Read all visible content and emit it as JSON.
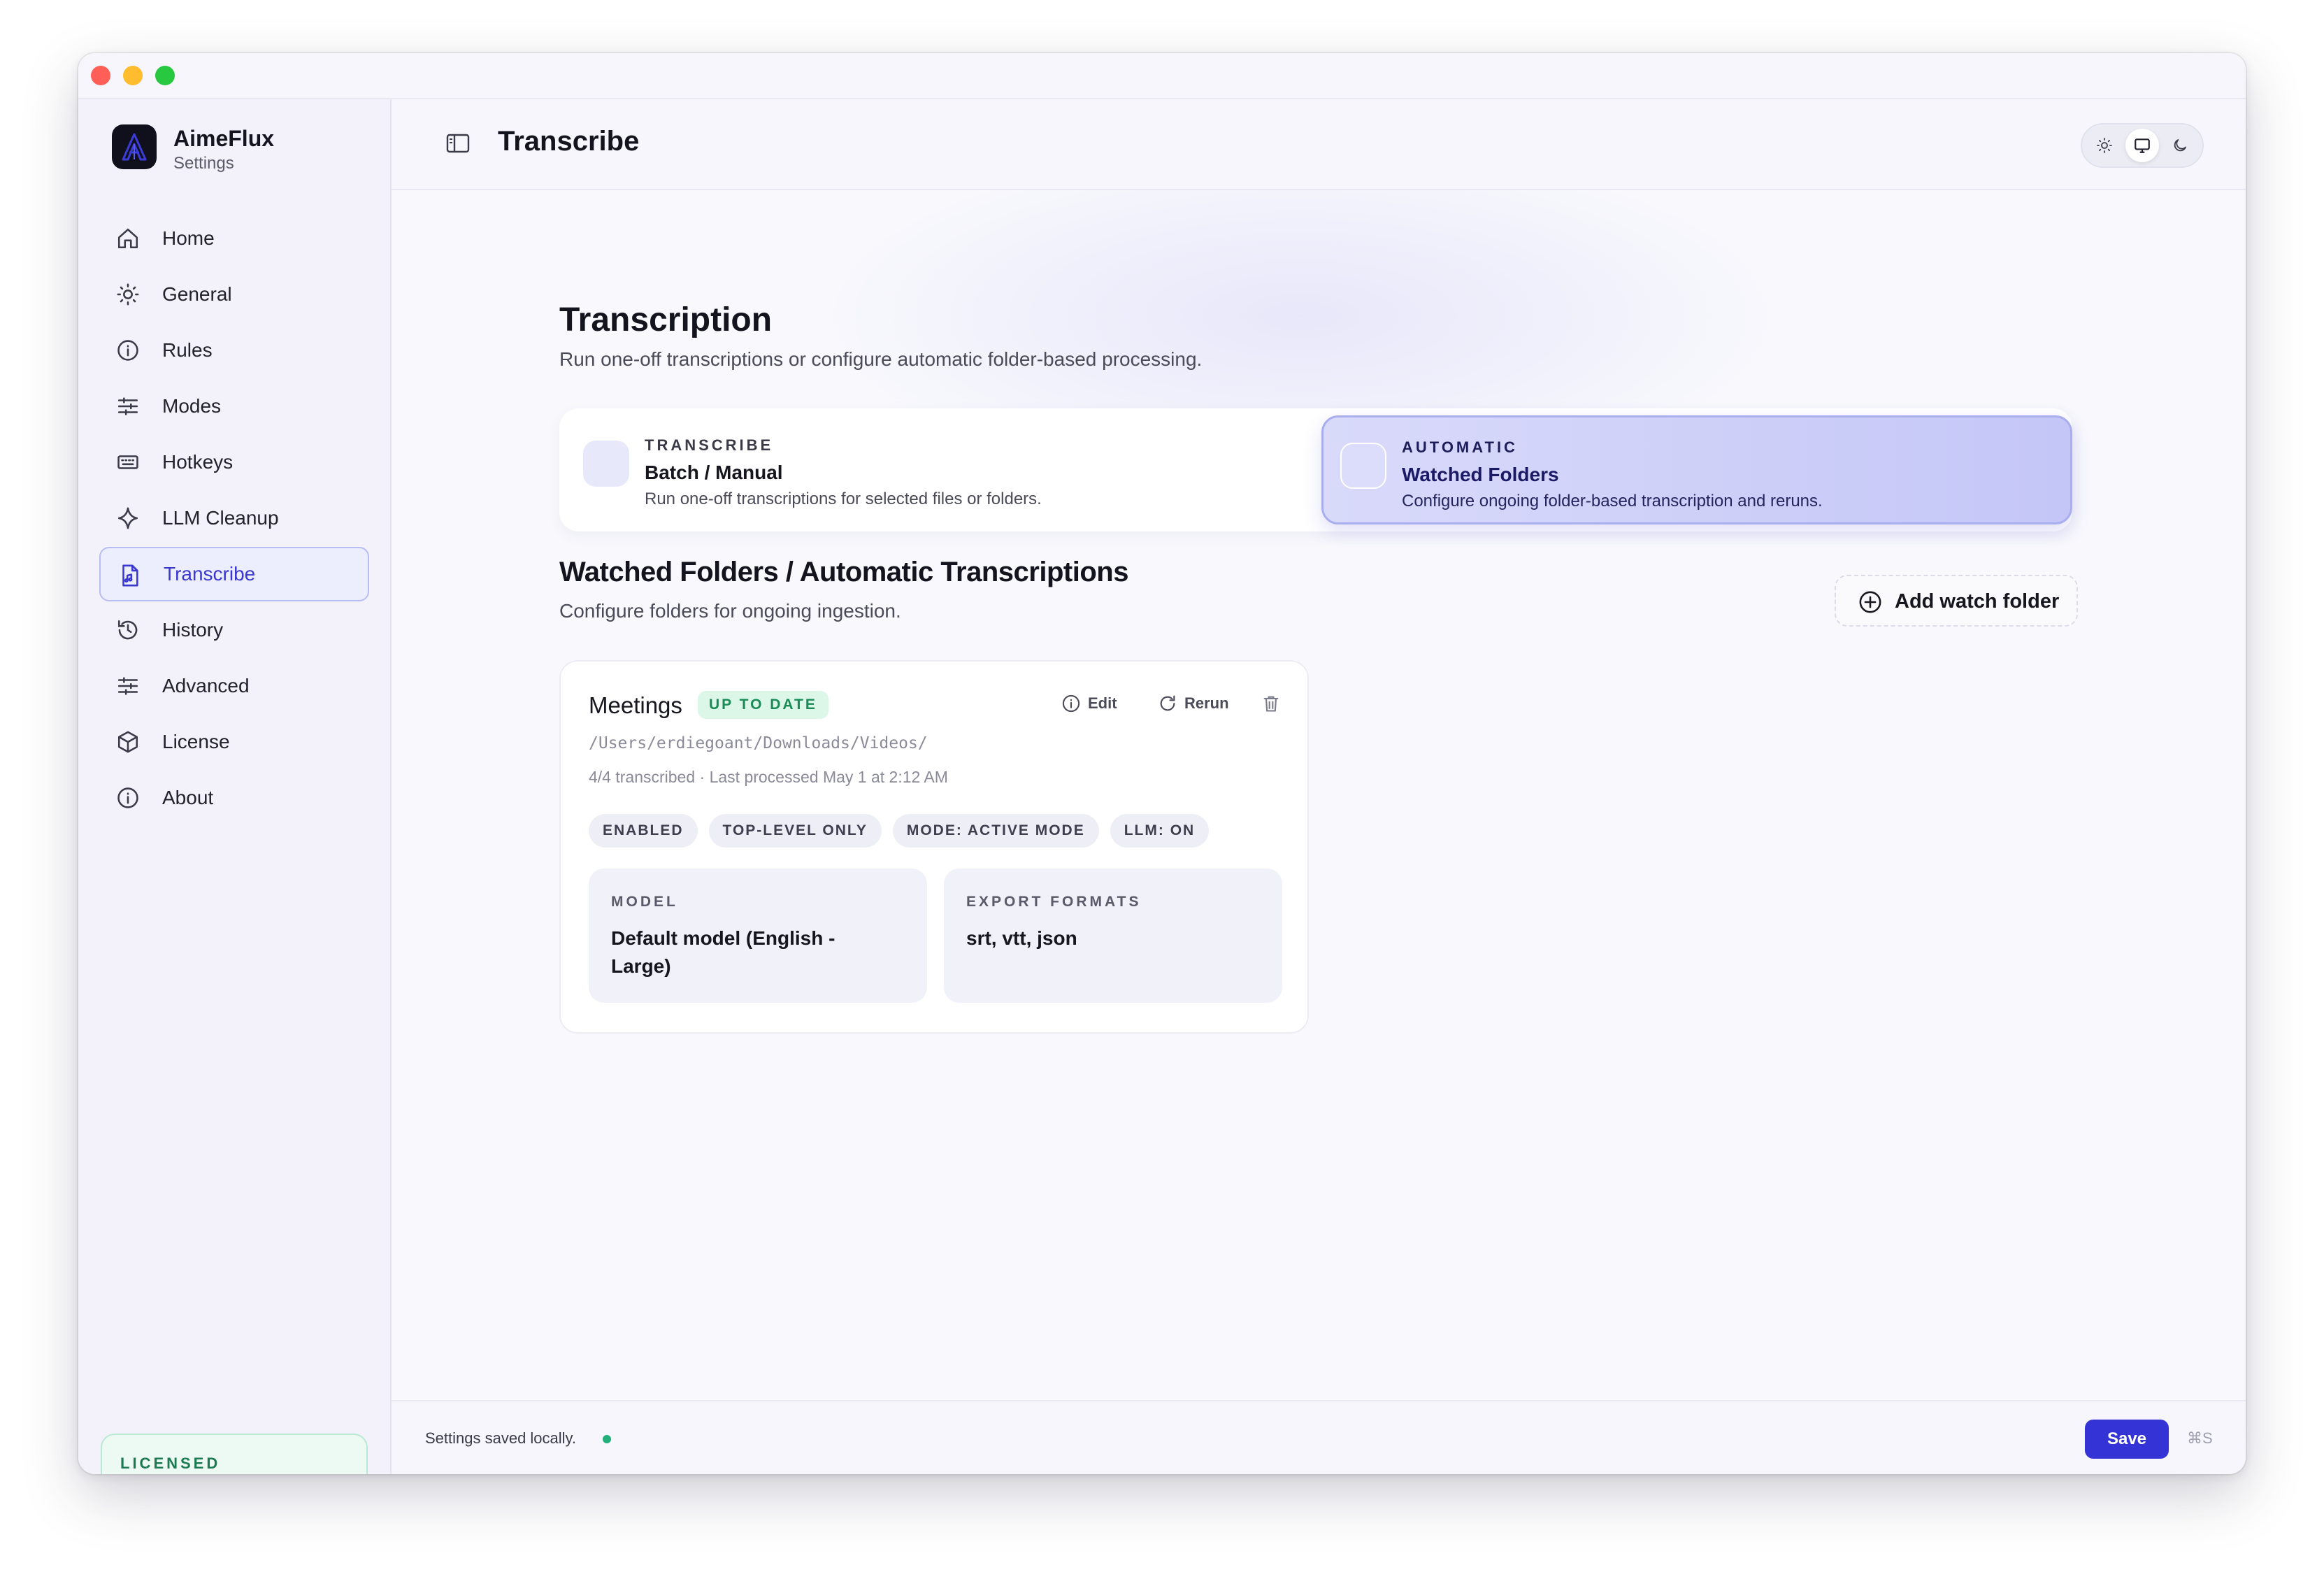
{
  "app": {
    "name": "AimeFlux",
    "subtitle": "Settings"
  },
  "sidebar": {
    "items": [
      {
        "label": "Home",
        "icon": "home-icon"
      },
      {
        "label": "General",
        "icon": "sun-icon"
      },
      {
        "label": "Rules",
        "icon": "info-icon"
      },
      {
        "label": "Modes",
        "icon": "sliders-icon"
      },
      {
        "label": "Hotkeys",
        "icon": "keyboard-icon"
      },
      {
        "label": "LLM Cleanup",
        "icon": "sparkle-icon"
      },
      {
        "label": "Transcribe",
        "icon": "file-audio-icon",
        "active": true
      },
      {
        "label": "History",
        "icon": "history-icon"
      },
      {
        "label": "Advanced",
        "icon": "sliders-icon"
      },
      {
        "label": "License",
        "icon": "box-icon"
      },
      {
        "label": "About",
        "icon": "info-icon"
      }
    ],
    "license_badge": "LICENSED"
  },
  "header": {
    "title": "Transcribe",
    "theme_options": [
      "light",
      "system",
      "dark"
    ],
    "theme_selected": "system"
  },
  "page": {
    "title": "Transcription",
    "subtitle": "Run one-off transcriptions or configure automatic folder-based processing."
  },
  "modes": [
    {
      "kicker": "TRANSCRIBE",
      "title": "Batch / Manual",
      "description": "Run one-off transcriptions for selected files or folders.",
      "selected": false
    },
    {
      "kicker": "AUTOMATIC",
      "title": "Watched Folders",
      "description": "Configure ongoing folder-based transcription and reruns.",
      "selected": true
    }
  ],
  "watched": {
    "title": "Watched Folders / Automatic Transcriptions",
    "subtitle": "Configure folders for ongoing ingestion.",
    "add_label": "Add watch folder",
    "folders": [
      {
        "name": "Meetings",
        "status": "UP TO DATE",
        "actions": {
          "edit": "Edit",
          "rerun": "Rerun"
        },
        "path": "/Users/erdiegoant/Downloads/Videos/",
        "meta": "4/4 transcribed · Last processed May 1 at 2:12 AM",
        "tags": [
          "ENABLED",
          "TOP-LEVEL ONLY",
          "MODE: ACTIVE MODE",
          "LLM: ON"
        ],
        "model_label": "MODEL",
        "model_value": "Default model (English - Large)",
        "export_label": "EXPORT FORMATS",
        "export_value": "srt, vtt, json"
      }
    ]
  },
  "footer": {
    "status": "Settings saved locally.",
    "save_label": "Save",
    "shortcut": "⌘S"
  },
  "colors": {
    "accent": "#3434d6",
    "success": "#22b07a",
    "selected_mode": "#c4c6f7"
  }
}
